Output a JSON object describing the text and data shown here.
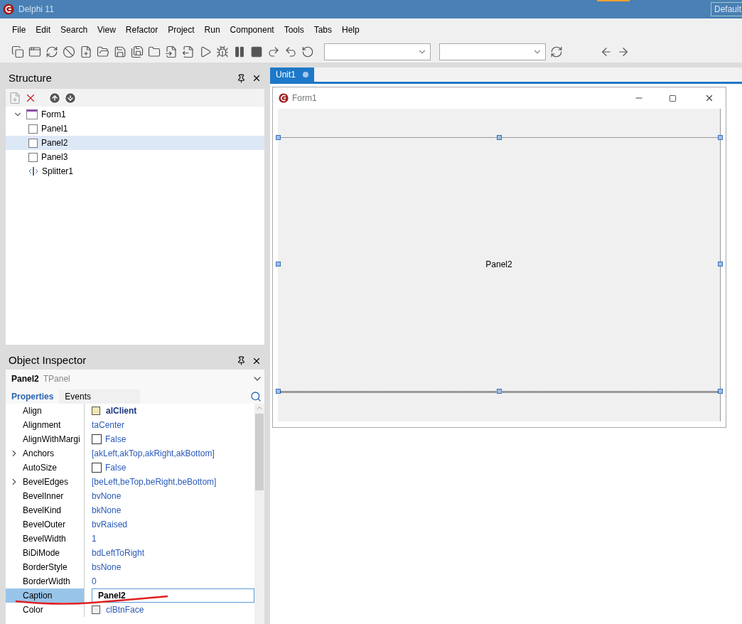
{
  "window": {
    "title": "Delphi 11",
    "layout_button": "Default"
  },
  "menu": [
    "File",
    "Edit",
    "Search",
    "View",
    "Refactor",
    "Project",
    "Run",
    "Component",
    "Tools",
    "Tabs",
    "Help"
  ],
  "structure": {
    "title": "Structure",
    "tree": [
      {
        "label": "Form1",
        "kind": "form",
        "expanded": true,
        "selected": false,
        "children": [
          {
            "label": "Panel1",
            "kind": "panel",
            "selected": false
          },
          {
            "label": "Panel2",
            "kind": "panel",
            "selected": true
          },
          {
            "label": "Panel3",
            "kind": "panel",
            "selected": false
          },
          {
            "label": "Splitter1",
            "kind": "splitter",
            "selected": false
          }
        ]
      }
    ]
  },
  "inspector": {
    "title": "Object Inspector",
    "object_name": "Panel2",
    "object_type": "TPanel",
    "tabs": [
      {
        "label": "Properties",
        "selected": true
      },
      {
        "label": "Events",
        "selected": false
      }
    ],
    "properties": [
      {
        "name": "Align",
        "value": "alClient",
        "kind": "swatch",
        "color": "#f2e6b3",
        "expandable": false,
        "modified": true,
        "selected": false
      },
      {
        "name": "Alignment",
        "value": "taCenter",
        "kind": "plain",
        "expandable": false,
        "modified": false,
        "selected": false
      },
      {
        "name": "AlignWithMargi",
        "value": "False",
        "kind": "checkbox",
        "checked": false,
        "expandable": false,
        "modified": false,
        "selected": false
      },
      {
        "name": "Anchors",
        "value": "[akLeft,akTop,akRight,akBottom]",
        "kind": "plain",
        "expandable": true,
        "modified": false,
        "selected": false
      },
      {
        "name": "AutoSize",
        "value": "False",
        "kind": "checkbox",
        "checked": false,
        "expandable": false,
        "modified": false,
        "selected": false
      },
      {
        "name": "BevelEdges",
        "value": "[beLeft,beTop,beRight,beBottom]",
        "kind": "plain",
        "expandable": true,
        "modified": false,
        "selected": false
      },
      {
        "name": "BevelInner",
        "value": "bvNone",
        "kind": "plain",
        "expandable": false,
        "modified": false,
        "selected": false
      },
      {
        "name": "BevelKind",
        "value": "bkNone",
        "kind": "plain",
        "expandable": false,
        "modified": false,
        "selected": false
      },
      {
        "name": "BevelOuter",
        "value": "bvRaised",
        "kind": "plain",
        "expandable": false,
        "modified": false,
        "selected": false
      },
      {
        "name": "BevelWidth",
        "value": "1",
        "kind": "plain",
        "expandable": false,
        "modified": false,
        "selected": false
      },
      {
        "name": "BiDiMode",
        "value": "bdLeftToRight",
        "kind": "plain",
        "expandable": false,
        "modified": false,
        "selected": false
      },
      {
        "name": "BorderStyle",
        "value": "bsNone",
        "kind": "plain",
        "expandable": false,
        "modified": false,
        "selected": false
      },
      {
        "name": "BorderWidth",
        "value": "0",
        "kind": "plain",
        "expandable": false,
        "modified": false,
        "selected": false
      },
      {
        "name": "Caption",
        "value": "Panel2",
        "kind": "edit",
        "expandable": false,
        "modified": true,
        "selected": true
      },
      {
        "name": "Color",
        "value": "clBtnFace",
        "kind": "swatch",
        "color": "#f0f0f0",
        "expandable": false,
        "modified": false,
        "selected": false
      }
    ]
  },
  "editor_tabs": [
    {
      "label": "Unit1",
      "selected": true,
      "modified": true
    }
  ],
  "form": {
    "title": "Form1",
    "panel_caption": "Panel2"
  }
}
